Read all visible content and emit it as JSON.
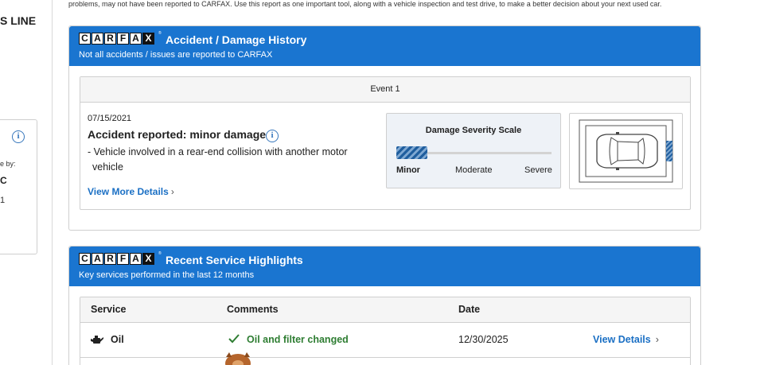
{
  "top_note": "problems, may not have been reported to CARFAX. Use this report as one important tool, along with a vehicle inspection and test drive, to make a better decision about your next used car.",
  "left_panel": {
    "title_fragment": "S LINE",
    "line1": "e by:",
    "line2": "C",
    "line3": "1"
  },
  "logo": {
    "letters": [
      "C",
      "A",
      "R",
      "F",
      "A",
      "X"
    ],
    "tm": "®"
  },
  "accident": {
    "title": "Accident / Damage History",
    "subtitle": "Not all accidents / issues are reported to CARFAX",
    "event": {
      "header": "Event 1",
      "date": "07/15/2021",
      "title": "Accident reported: minor damage",
      "description": "- Vehicle involved in a rear-end collision with another motor vehicle",
      "link": "View More Details",
      "severity": {
        "title": "Damage Severity Scale",
        "labels": [
          "Minor",
          "Moderate",
          "Severe"
        ],
        "level": 0.2
      }
    }
  },
  "service": {
    "title": "Recent Service Highlights",
    "subtitle": "Key services performed in the last 12 months",
    "columns": [
      "Service",
      "Comments",
      "Date"
    ],
    "rows": [
      {
        "service": "Oil",
        "comment": "Oil and filter changed",
        "date": "12/30/2025",
        "link": "View Details"
      }
    ]
  },
  "colors": {
    "brand_blue": "#1a75d0",
    "link_blue": "#1a6fc4",
    "comment_green": "#2e7d32"
  }
}
